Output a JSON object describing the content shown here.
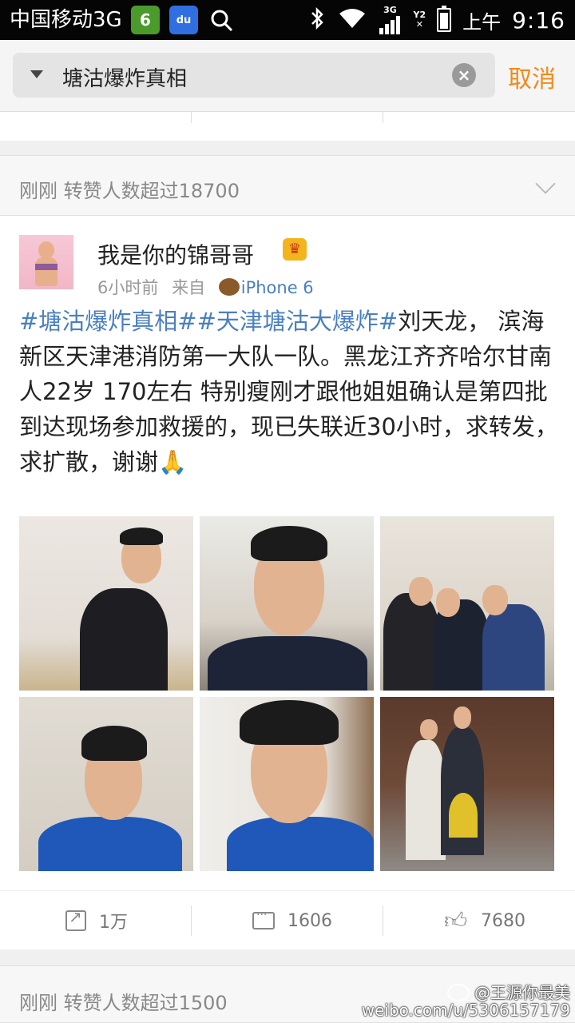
{
  "status_bar": {
    "carrier": "中国移动3G",
    "time": "9:16",
    "ampm": "上午",
    "network": "3G",
    "sim2": "Y2"
  },
  "search": {
    "query": "塘沽爆炸真相",
    "cancel_label": "取消"
  },
  "card_top": {
    "header": "刚刚 转赞人数超过18700"
  },
  "post": {
    "username": "我是你的锦哥哥",
    "time": "6小时前",
    "from": "来自",
    "source": "iPhone 6",
    "topic1": "#塘沽爆炸真相#",
    "topic2": "#天津塘沽大爆炸#",
    "text": "刘天龙，  滨海新区天津港消防第一大队一队。黑龙江齐齐哈尔甘南人22岁   170左右  特别瘦刚才跟他姐姐确认是第四批到达现场参加救援的，现已失联近30小时，求转发，求扩散，谢谢🙏",
    "photos": [
      "photo-1",
      "photo-2",
      "photo-3",
      "photo-4",
      "photo-5",
      "photo-6"
    ],
    "repost_count": "1万",
    "comment_count": "1606",
    "like_count": "7680"
  },
  "card_next": {
    "header": "刚刚 转赞人数超过1500"
  },
  "watermark": {
    "line1": "@王源你最美",
    "line2": "weibo.com/u/5306157179"
  },
  "colors": {
    "accent_orange": "#f08b18",
    "link_blue": "#4a7fc1"
  }
}
